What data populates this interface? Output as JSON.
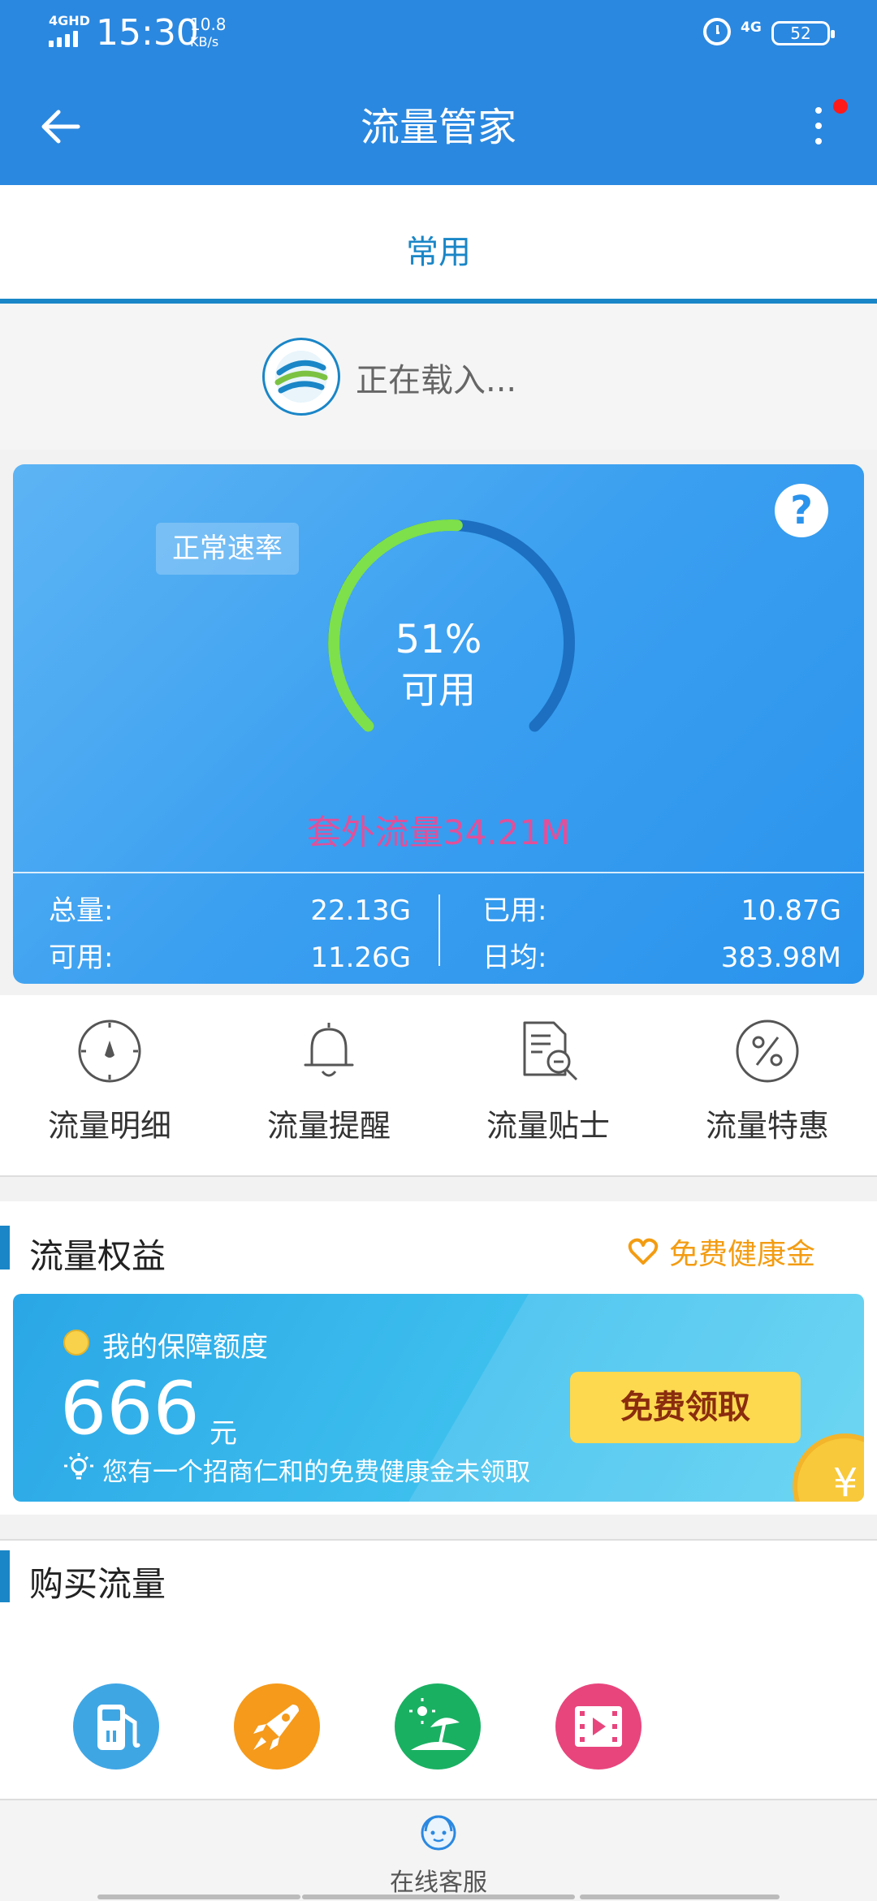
{
  "status_bar": {
    "network": "4GHD",
    "time": "15:30",
    "speed": "10.8",
    "speed_unit": "KB/s",
    "network_right": "4G",
    "battery": "52"
  },
  "header": {
    "title": "流量管家",
    "back_icon": "arrow-left-icon",
    "more_icon": "more-vertical-icon"
  },
  "tabs": [
    {
      "label": "常用",
      "active": true
    }
  ],
  "operator": {
    "loading_text": "正在载入..."
  },
  "usage": {
    "rate_badge": "正常速率",
    "available_percent": "51%",
    "available_label": "可用",
    "available_fraction": 0.51,
    "overage_text": "套外流量34.21M",
    "stats": {
      "total_label": "总量:",
      "total_value": "22.13G",
      "available_label": "可用:",
      "available_value": "11.26G",
      "used_label": "已用:",
      "used_value": "10.87G",
      "daily_label": "日均:",
      "daily_value": "383.98M"
    },
    "colors": {
      "gauge_used": "#7ee04a",
      "gauge_remaining": "#1c6fc1",
      "overage": "#e0509a"
    }
  },
  "shortcuts": [
    {
      "label": "流量明细",
      "icon": "compass-icon"
    },
    {
      "label": "流量提醒",
      "icon": "bell-icon"
    },
    {
      "label": "流量贴士",
      "icon": "document-search-icon"
    },
    {
      "label": "流量特惠",
      "icon": "percent-icon"
    }
  ],
  "benefits": {
    "title": "流量权益",
    "health_link": "免费健康金",
    "banner": {
      "label": "我的保障额度",
      "amount": "666",
      "unit": "元",
      "tip": "您有一个招商仁和的免费健康金未领取",
      "button": "免费领取",
      "coin_symbol": "¥"
    }
  },
  "buy": {
    "title": "购买流量",
    "items": [
      {
        "icon": "gas-station-icon",
        "color": "#3fa6e4"
      },
      {
        "icon": "rocket-icon",
        "color": "#f59a1b"
      },
      {
        "icon": "beach-icon",
        "color": "#19b062"
      },
      {
        "icon": "video-icon",
        "color": "#e8457d"
      }
    ]
  },
  "bottom_nav": {
    "label": "在线客服",
    "icon": "customer-service-icon"
  }
}
